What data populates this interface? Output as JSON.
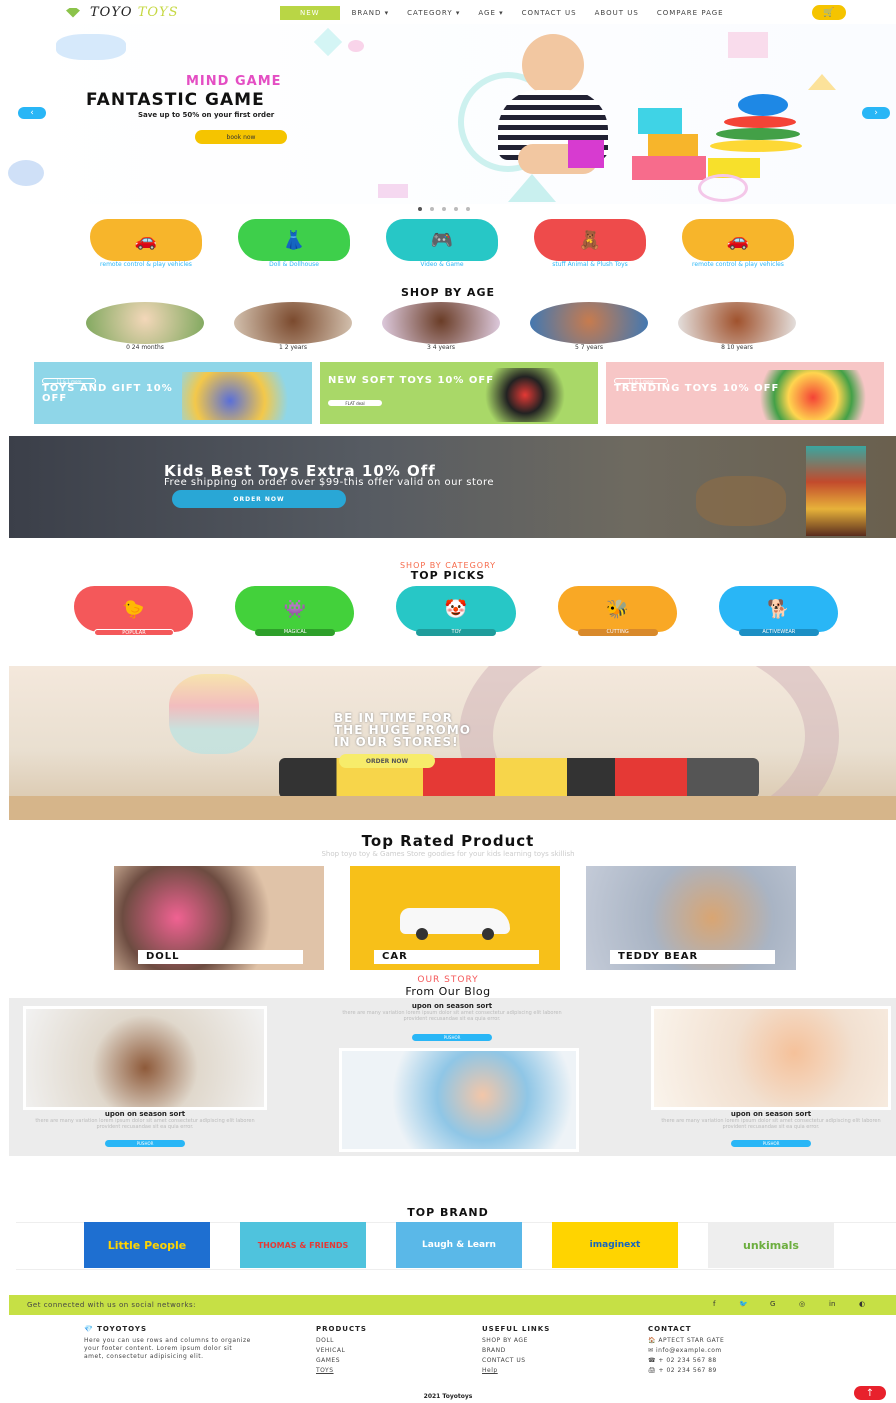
{
  "nav": {
    "logo_a": "TOYO",
    "logo_b": "TOYS",
    "items": [
      "NEW",
      "BRAND",
      "CATEGORY",
      "AGE",
      "CONTACT US",
      "ABOUT US",
      "COMPARE PAGE"
    ],
    "cart_icon": "cart-icon"
  },
  "hero": {
    "subtitle": "MIND GAME",
    "title": "FANTASTIC GAME",
    "text": "Save up to 50% on your first order",
    "button": "book now",
    "prev": "‹",
    "next": "›"
  },
  "categories": [
    {
      "label": "remote control & play vehicles",
      "color": "#f7b52b",
      "icon": "car-icon"
    },
    {
      "label": "Doll & Dollhouse",
      "color": "#3ecf4b",
      "icon": "doll-icon"
    },
    {
      "label": "Video & Game",
      "color": "#27c7c6",
      "icon": "gamepad-icon"
    },
    {
      "label": "stuff Animal & Plush Toys",
      "color": "#ee4b4b",
      "icon": "bear-icon"
    },
    {
      "label": "remote control & play vehicles",
      "color": "#f7b52b",
      "icon": "car-icon"
    }
  ],
  "shop_by_age": {
    "title": "SHOP BY AGE",
    "items": [
      "0 24 months",
      "1 2 years",
      "3 4 years",
      "5 7 years",
      "8 10 years"
    ]
  },
  "promos": [
    {
      "badge": "11 & 1 more",
      "title": "TOYS AND GIFT 10% OFF",
      "bg": "#8fd6e8"
    },
    {
      "badge": "FLAT deal",
      "title": "NEW SOFT TOYS 10% OFF",
      "bg": "#a9d868"
    },
    {
      "badge": "11 & 1 more",
      "title": "TRENDING TOYS 10% OFF",
      "bg": "#f7c6c6"
    }
  ],
  "offer_band": {
    "title": "Kids Best Toys Extra 10% Off",
    "text": "Free shipping on order over $99-this offer valid on our store",
    "button": "ORDER NOW"
  },
  "top_picks": {
    "kicker": "SHOP BY CATEGORY",
    "title": "TOP PICKS",
    "items": [
      {
        "label": "POPULAR",
        "color": "#f4585a",
        "tag": "#f4585a"
      },
      {
        "label": "MAGICAL",
        "color": "#43d13b",
        "tag": "#43d13b"
      },
      {
        "label": "TOY",
        "color": "#27c7c6",
        "tag": "#27c7c6"
      },
      {
        "label": "CUTTING",
        "color": "#f9a825",
        "tag": "#f9a825"
      },
      {
        "label": "ACTIVEWEAR",
        "color": "#29b6f6",
        "tag": "#29b6f6"
      }
    ]
  },
  "promo_band": {
    "line1": "BE IN TIME FOR",
    "line2": "THE HUGE PROMO",
    "line3": "IN OUR STORES!",
    "button": "ORDER NOW"
  },
  "top_rated": {
    "title": "Top Rated Product",
    "subtitle": "Shop toyo toy & Games Store goodies for your kids learning toys skillish",
    "items": [
      "DOLL",
      "CAR",
      "TEDDY BEAR"
    ]
  },
  "blog": {
    "kicker": "OUR STORY",
    "title": "From Our Blog",
    "posts": [
      {
        "title": "upon on season sort",
        "text": "there are many variation lorem ipsum dolor sit amet consectetur adipiscing elit laboren provident recusandae sit ea quia error.",
        "button": "PUSHOR"
      },
      {
        "title": "upon on season sort",
        "text": "there are many variation lorem ipsum dolor sit amet consectetur adipiscing elit laboren provident recusandae sit ea quia error.",
        "button": "PUSHOR"
      },
      {
        "title": "upon on season sort",
        "text": "there are many variation lorem ipsum dolor sit amet consectetur adipiscing elit laboren provident recusandae sit ea quia error.",
        "button": "PUSHOR"
      }
    ]
  },
  "top_brand": {
    "title": "TOP BRAND",
    "items": [
      {
        "name": "Little People",
        "bg": "#1e6fd1",
        "fg": "#ffd400"
      },
      {
        "name": "THOMAS & FRIENDS",
        "bg": "#4fc3dd",
        "fg": "#e53935"
      },
      {
        "name": "Laugh & Learn",
        "bg": "#5ab8e8",
        "fg": "#ffffff"
      },
      {
        "name": "imaginext",
        "bg": "#ffd400",
        "fg": "#1565c0"
      },
      {
        "name": "unkimals",
        "bg": "#eeeeee",
        "fg": "#6cae3f"
      }
    ]
  },
  "social_bar": {
    "text": "Get connected with us on social networks:",
    "icons": [
      "facebook-icon",
      "twitter-icon",
      "google-icon",
      "instagram-icon",
      "linkedin-icon",
      "github-icon"
    ]
  },
  "footer": {
    "brand": "TOYOTOYS",
    "about": "Here you can use rows and columns to organize your footer content. Lorem ipsum dolor sit amet, consectetur adipisicing elit.",
    "products_title": "PRODUCTS",
    "products": [
      "DOLL",
      "VEHICAL",
      "GAMES",
      "TOYS"
    ],
    "links_title": "USEFUL LINKS",
    "links": [
      "SHOP BY AGE",
      "BRAND",
      "CONTACT US",
      "Help"
    ],
    "contact_title": "CONTACT",
    "contact": [
      "APTECT STAR GATE",
      "info@example.com",
      "+ 02 234 567 88",
      "+ 02 234 567 89"
    ],
    "copyright": "2021 Toyotoys"
  }
}
